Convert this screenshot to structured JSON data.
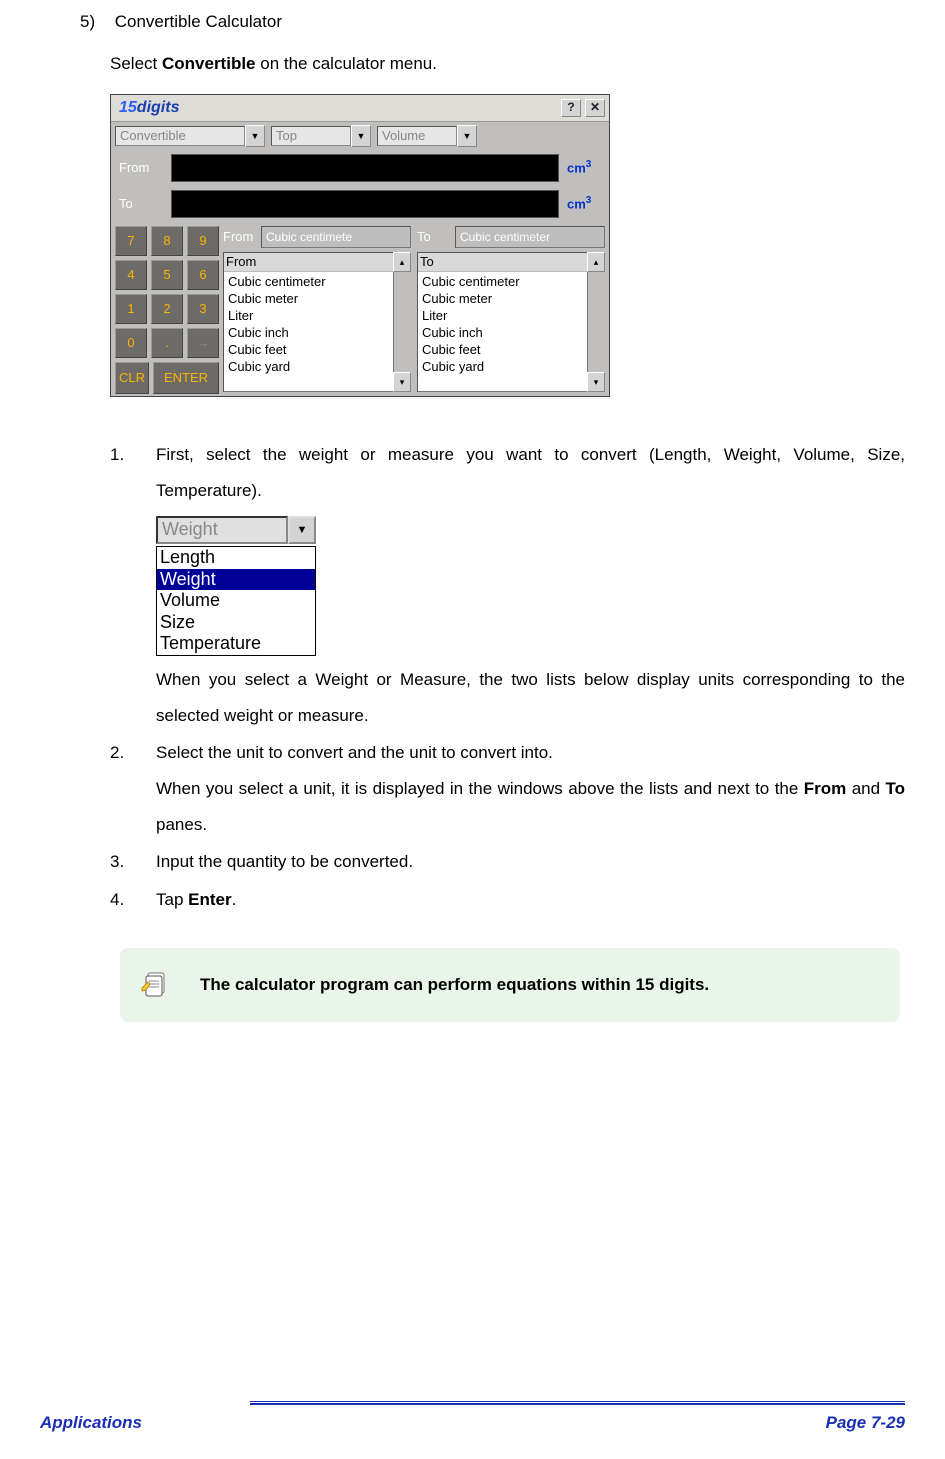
{
  "section": {
    "num": "5)",
    "title": "Convertible Calculator"
  },
  "intro": {
    "prefix": "Select ",
    "bold": "Convertible",
    "suffix": " on the calculator menu."
  },
  "calc": {
    "title15": "15",
    "titleDigits": "digits",
    "help": "?",
    "close": "✕",
    "combos": {
      "convertible": "Convertible",
      "top": "Top",
      "volume": "Volume"
    },
    "rows": {
      "from": "From",
      "to": "To"
    },
    "unit": "cm",
    "unitSup": "3",
    "keys": {
      "k7": "7",
      "k8": "8",
      "k9": "9",
      "k4": "4",
      "k5": "5",
      "k6": "6",
      "k1": "1",
      "k2": "2",
      "k3": "3",
      "k0": "0",
      "kdot": ".",
      "karr": "→",
      "clr": "CLR",
      "enter": "ENTER"
    },
    "unitRow": {
      "from": "From",
      "to": "To",
      "fromVal": "Cubic centimete",
      "toVal": "Cubic centimeter"
    },
    "listFrom": {
      "header": "From",
      "i1": "Cubic centimeter",
      "i2": "Cubic meter",
      "i3": "Liter",
      "i4": "Cubic inch",
      "i5": "Cubic feet",
      "i6": "Cubic yard"
    },
    "listTo": {
      "header": "To",
      "i1": "Cubic centimeter",
      "i2": "Cubic meter",
      "i3": "Liter",
      "i4": "Cubic inch",
      "i5": "Cubic feet",
      "i6": "Cubic yard"
    }
  },
  "steps": {
    "s1num": "1.",
    "s1a": "First, select the weight or measure you want to convert (Length, Weight, Volume, Size, Temperature).",
    "s1b": "When you select a Weight or Measure, the two lists below display units corresponding to the selected weight or measure.",
    "s2num": "2.",
    "s2a": "Select the unit to convert and the unit to convert into.",
    "s2b_pre": "When you select a unit, it is displayed in the windows above the lists and next to the ",
    "s2b_from": "From",
    "s2b_mid": " and ",
    "s2b_to": "To",
    "s2b_post": " panes.",
    "s3num": "3.",
    "s3": "Input the quantity to be converted.",
    "s4num": "4.",
    "s4_pre": "Tap ",
    "s4_bold": "Enter",
    "s4_post": "."
  },
  "weightDD": {
    "field": "Weight",
    "i1": "Length",
    "i2": "Weight",
    "i3": "Volume",
    "i4": "Size",
    "i5": "Temperature"
  },
  "note": "The calculator program can perform equations within 15 digits.",
  "footer": {
    "left": "Applications",
    "right": "Page 7-29"
  }
}
